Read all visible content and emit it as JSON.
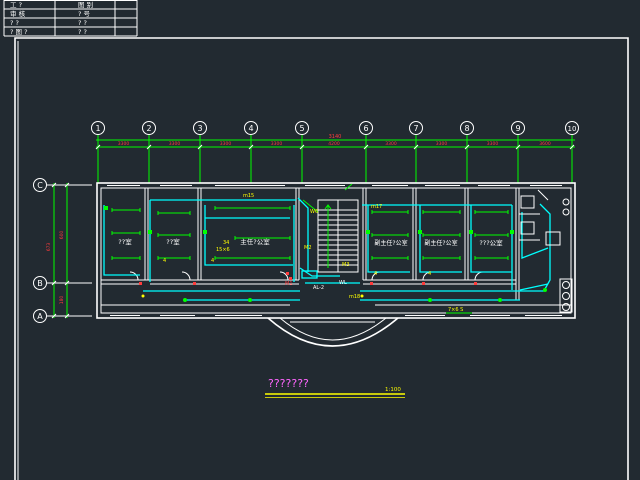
{
  "title_block": {
    "rows": [
      {
        "c1": "工  ?",
        "c2": "图  别"
      },
      {
        "c1": "审  核",
        "c2": "?  号"
      },
      {
        "c1": "?  ?",
        "c2": "?  ?"
      },
      {
        "c1": "? 图 ?",
        "c2": "?  ?"
      }
    ]
  },
  "axes": {
    "top": [
      "1",
      "2",
      "3",
      "4",
      "5",
      "6",
      "7",
      "8",
      "9",
      "10"
    ],
    "left": [
      "C",
      "B",
      "A"
    ]
  },
  "dims": {
    "total": "3140",
    "top": [
      "3300",
      "3300",
      "3300",
      "3300",
      "4200",
      "3300",
      "3300",
      "3300",
      "3600"
    ],
    "left": [
      "673",
      "600",
      "180"
    ]
  },
  "rooms": [
    "??室",
    "??室",
    "主任?公室",
    "副主任?公室",
    "副主任?公室",
    "???公室"
  ],
  "tags": {
    "m15": "m15",
    "w6": "W6",
    "m17": "m17",
    "m2": "M2",
    "m3": "M3",
    "m1": "M1",
    "al2": "AL-2",
    "wl": "WL",
    "m18": "m18",
    "n34": "34",
    "n15x6": "15×6",
    "n7x6s": "7×6 S",
    "four": "4"
  },
  "drawing_title": "???????",
  "scale": "1:100",
  "colors": {
    "background": "#222a31",
    "line": "#ffffff",
    "wire": "#00ffff",
    "lamp": "#00ff00",
    "label": "#ffff00",
    "dimension": "#ff3c3c",
    "title": "#ff66ff"
  }
}
